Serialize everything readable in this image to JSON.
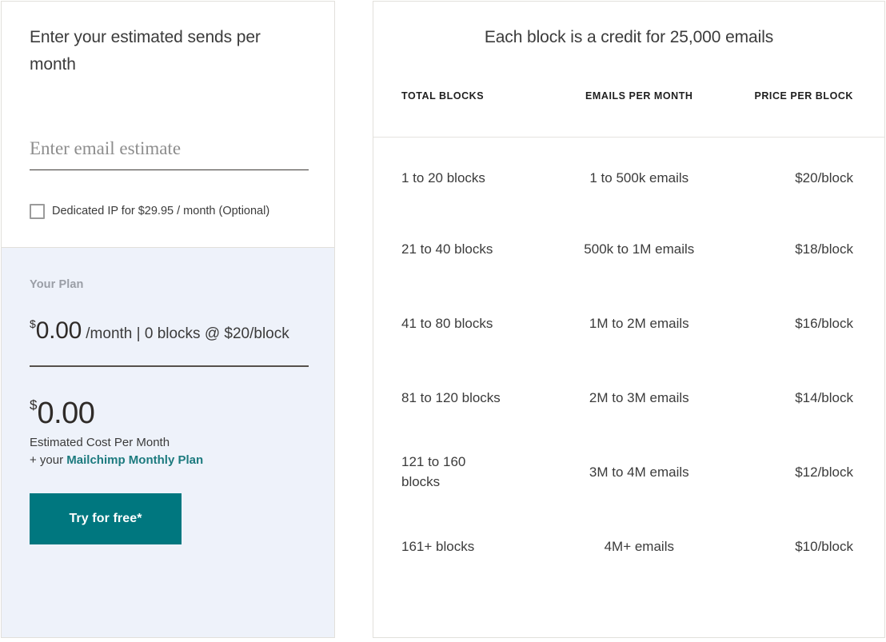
{
  "calculator": {
    "heading": "Enter your estimated sends per month",
    "email_input": {
      "placeholder": "Enter email estimate",
      "value": ""
    },
    "dedicated_ip": {
      "label": "Dedicated IP for $29.95 / month (Optional)",
      "checked": false
    },
    "plan": {
      "label": "Your Plan",
      "price_amount": "0.00",
      "currency_symbol": "$",
      "price_suffix": "/month | 0 blocks @ $20/block",
      "estimate_amount": "0.00",
      "estimate_caption": "Estimated Cost Per Month",
      "note_prefix": "+ your ",
      "note_link": "Mailchimp Monthly Plan",
      "cta_label": "Try for free*"
    }
  },
  "pricing": {
    "title": "Each block is a credit for 25,000 emails",
    "columns": [
      "TOTAL BLOCKS",
      "EMAILS PER MONTH",
      "PRICE PER BLOCK"
    ],
    "rows": [
      {
        "blocks": "1 to 20 blocks",
        "emails": "1 to 500k emails",
        "price": "$20/block"
      },
      {
        "blocks": "21 to 40 blocks",
        "emails": "500k to 1M emails",
        "price": "$18/block"
      },
      {
        "blocks": "41 to 80 blocks",
        "emails": "1M to 2M emails",
        "price": "$16/block"
      },
      {
        "blocks": "81 to 120 blocks",
        "emails": "2M to 3M emails",
        "price": "$14/block"
      },
      {
        "blocks": "121 to 160 blocks",
        "emails": "3M to 4M emails",
        "price": "$12/block"
      },
      {
        "blocks": "161+ blocks",
        "emails": "4M+ emails",
        "price": "$10/block"
      }
    ]
  },
  "colors": {
    "accent_teal": "#00777f",
    "link_teal": "#1c7a7e",
    "plan_bg": "#eef2fa",
    "border": "#e2e0db"
  }
}
